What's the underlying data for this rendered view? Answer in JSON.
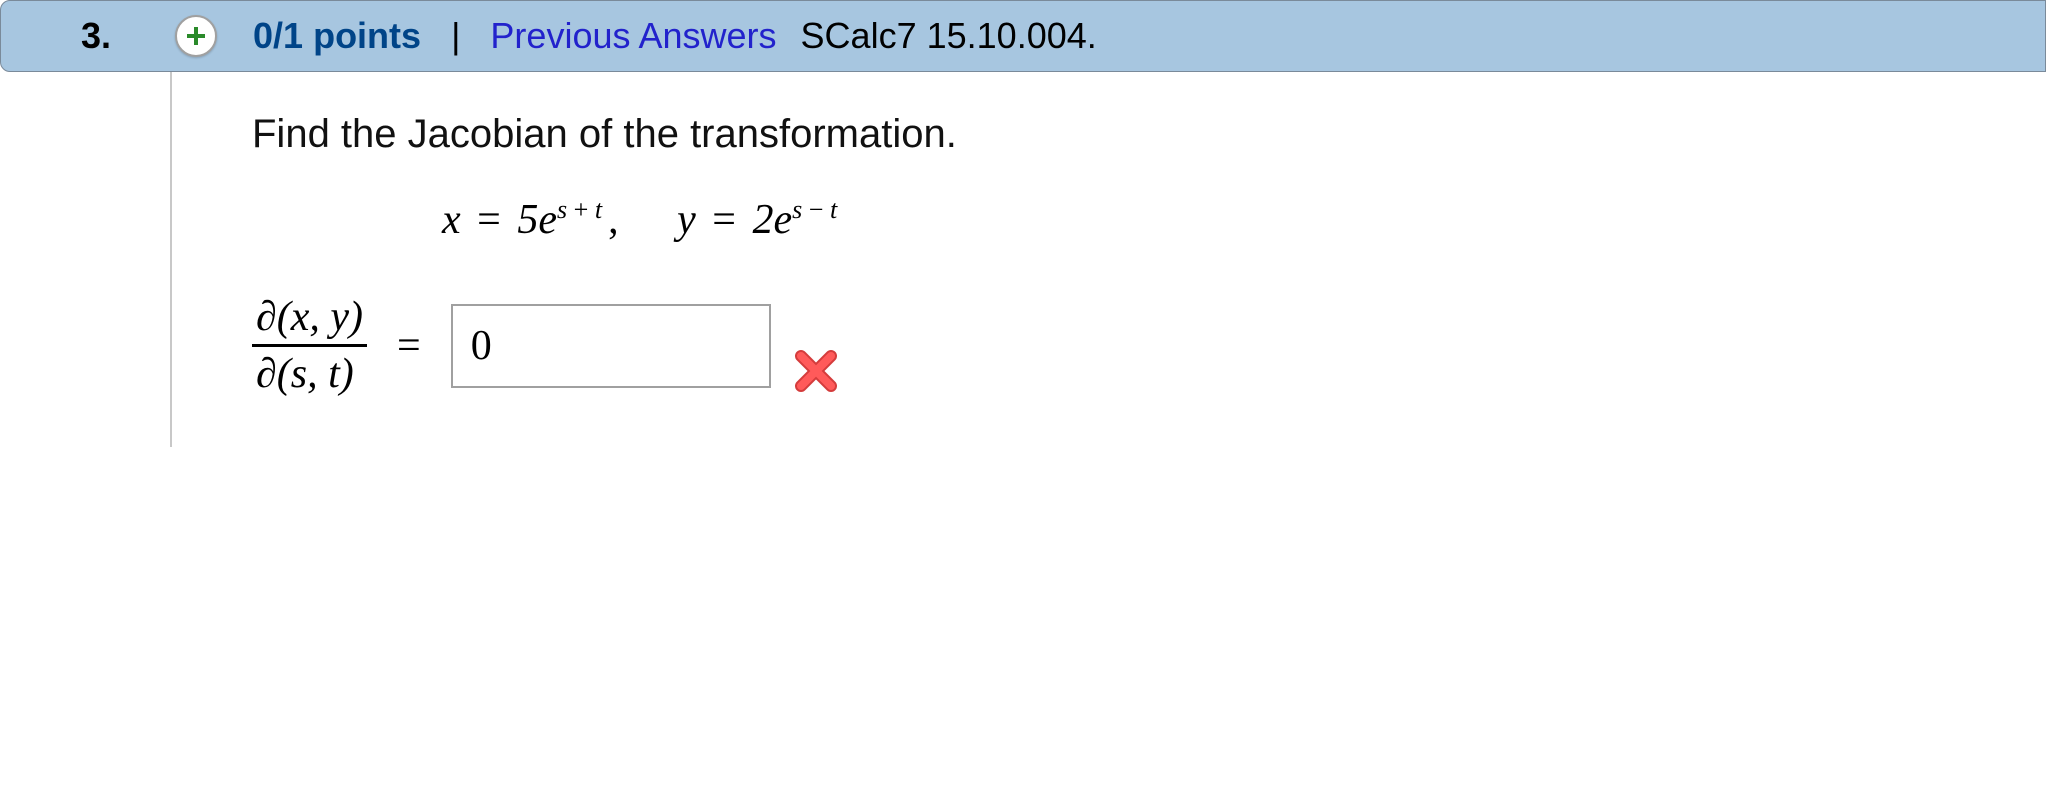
{
  "header": {
    "question_number": "3.",
    "points_text": "0/1 points",
    "divider": "|",
    "previous_answers_label": "Previous Answers",
    "source_label": "SCalc7 15.10.004."
  },
  "question": {
    "prompt": "Find the Jacobian of the transformation.",
    "equation_x": {
      "var": "x",
      "coef": "5",
      "exp_terms": [
        "s",
        "+",
        "t"
      ]
    },
    "equation_y": {
      "var": "y",
      "coef": "2",
      "exp_terms": [
        "s",
        "−",
        "t"
      ]
    },
    "jacobian": {
      "numerator": "∂(x, y)",
      "denominator": "∂(s, t)"
    },
    "answer_value": "0",
    "answer_status": "incorrect"
  }
}
